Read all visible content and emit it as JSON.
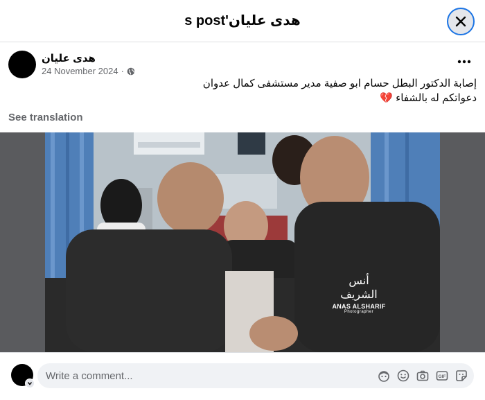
{
  "header": {
    "title": "هدى عليان's post"
  },
  "post": {
    "author": "هدى عليان",
    "date": "24 November 2024",
    "separator": "·",
    "text_line1": "إصابة الدكتور البطل حسام ابو صفية مدير مستشفى كمال عدوان",
    "text_line2": "دعواتكم له بالشفاء 💔",
    "see_translation": "See translation",
    "watermark_arabic": "أنس الشريف",
    "watermark_name": "ANAS ALSHARIF",
    "watermark_sub": "Photographer"
  },
  "comment": {
    "placeholder": "Write a comment..."
  },
  "icons": {
    "close": "close-icon",
    "more": "more-options-icon",
    "privacy": "globe-icon",
    "avatar_sticker": "avatar-sticker-icon",
    "emoji": "emoji-icon",
    "camera": "camera-icon",
    "gif": "gif-icon",
    "sticker": "sticker-icon"
  },
  "colors": {
    "accent": "#1b74e4",
    "secondary_text": "#65676b",
    "input_bg": "#f0f2f5"
  }
}
